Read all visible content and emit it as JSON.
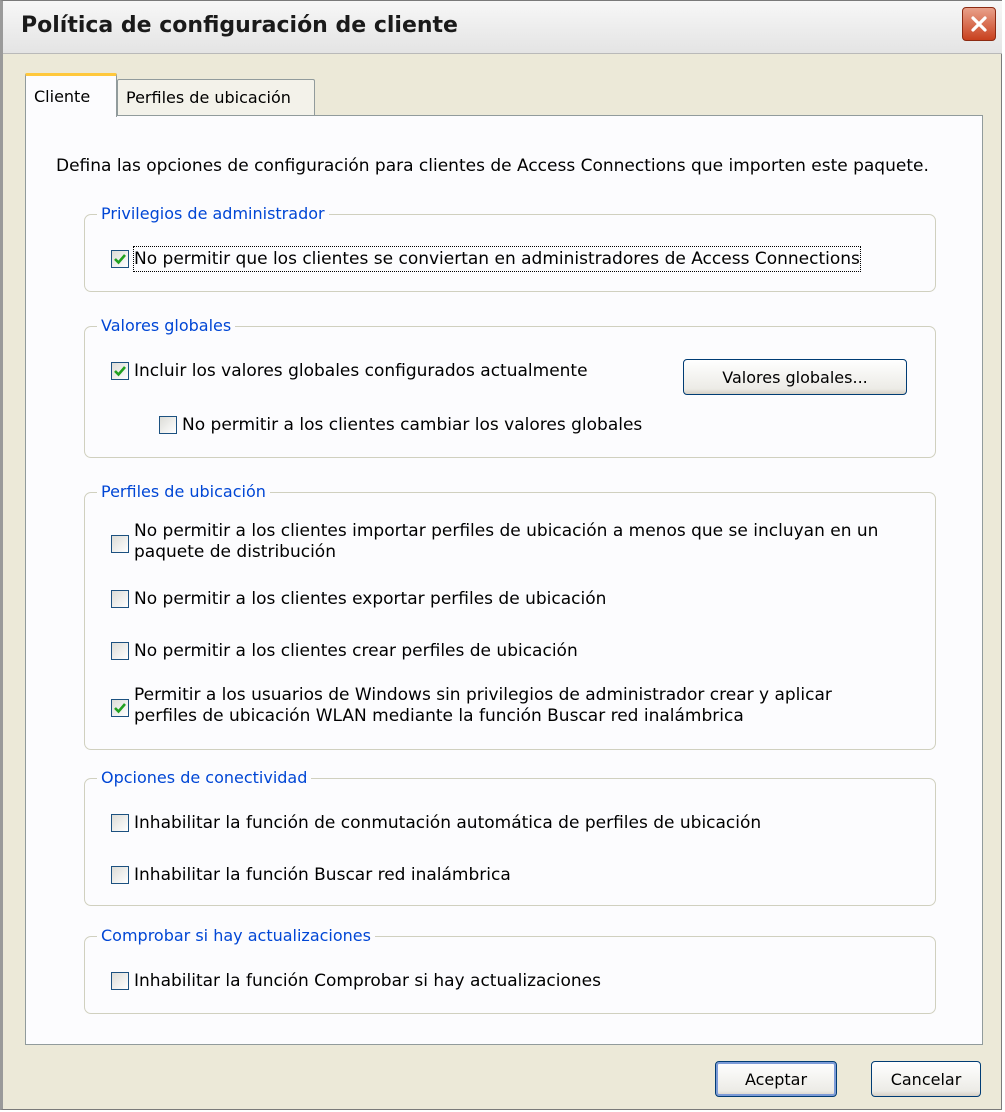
{
  "window": {
    "title": "Política de configuración de cliente"
  },
  "tabs": [
    {
      "label": "Cliente",
      "active": true
    },
    {
      "label": "Perfiles de ubicación",
      "active": false
    }
  ],
  "intro": "Defina las opciones de configuración para clientes de Access Connections que importen este paquete.",
  "groups": {
    "admin": {
      "title": "Privilegios de administrador",
      "items": [
        {
          "label": "No permitir que los clientes se conviertan en administradores de Access Connections",
          "checked": true
        }
      ]
    },
    "global": {
      "title": "Valores globales",
      "items": [
        {
          "label": "Incluir los valores globales configurados actualmente",
          "checked": true
        },
        {
          "label": "No permitir a los clientes cambiar los valores globales",
          "checked": false
        }
      ],
      "button": "Valores globales..."
    },
    "profiles": {
      "title": "Perfiles de ubicación",
      "items": [
        {
          "label": "No permitir a los clientes importar perfiles de ubicación a menos que se incluyan en un paquete de distribución",
          "checked": false
        },
        {
          "label": "No permitir a los clientes exportar perfiles de ubicación",
          "checked": false
        },
        {
          "label": "No permitir a los clientes crear perfiles de ubicación",
          "checked": false
        },
        {
          "label": "Permitir a los usuarios de Windows sin privilegios de administrador crear y aplicar perfiles de ubicación WLAN mediante la función Buscar red inalámbrica",
          "checked": true
        }
      ]
    },
    "connectivity": {
      "title": "Opciones de conectividad",
      "items": [
        {
          "label": "Inhabilitar la función de conmutación automática de perfiles de ubicación",
          "checked": false
        },
        {
          "label": "Inhabilitar la función Buscar red inalámbrica",
          "checked": false
        }
      ]
    },
    "updates": {
      "title": "Comprobar si hay actualizaciones",
      "items": [
        {
          "label": "Inhabilitar la función Comprobar si hay actualizaciones",
          "checked": false
        }
      ]
    }
  },
  "buttons": {
    "ok": "Aceptar",
    "cancel": "Cancelar"
  },
  "colors": {
    "group_title": "#0046d5",
    "check_mark": "#21a121",
    "close_button": "#c8401e",
    "active_tab_accent": "#ffc83c"
  }
}
